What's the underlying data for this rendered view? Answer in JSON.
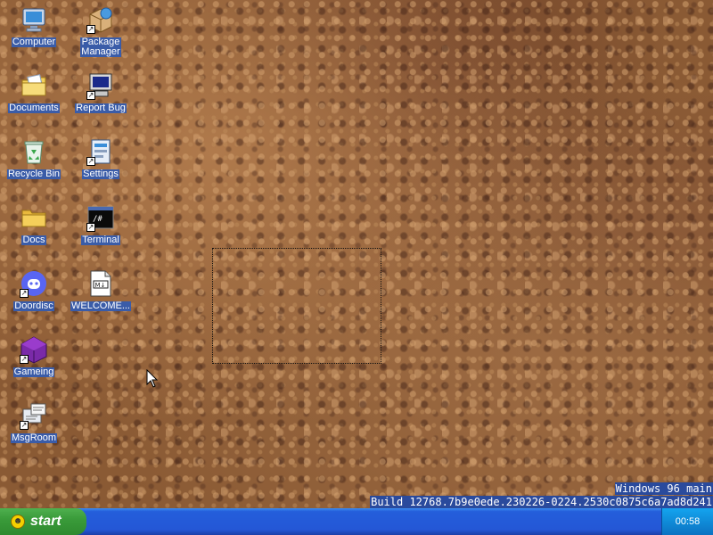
{
  "desktop": {
    "icons": [
      {
        "label": "Computer",
        "icon": "computer-icon"
      },
      {
        "label": "Package\nManager",
        "icon": "package-manager-icon"
      },
      {
        "label": "Documents",
        "icon": "documents-icon"
      },
      {
        "label": "Report Bug",
        "icon": "report-bug-icon"
      },
      {
        "label": "Recycle Bin",
        "icon": "recycle-bin-icon"
      },
      {
        "label": "Settings",
        "icon": "settings-icon"
      },
      {
        "label": "Docs",
        "icon": "folder-icon"
      },
      {
        "label": "Terminal",
        "icon": "terminal-icon",
        "glyph_text": "/#"
      },
      {
        "label": "Doordisc",
        "icon": "doordisc-icon"
      },
      {
        "label": "WELCOME...",
        "icon": "markdown-file-icon",
        "glyph_text": "M↓"
      },
      {
        "label": "Gameing",
        "icon": "gameing-icon"
      },
      {
        "label": "MsgRoom",
        "icon": "msgroom-icon"
      }
    ]
  },
  "build_banner": {
    "line1": "Windows 96 main",
    "line2": "Build 12768.7b9e0ede.230226-0224.2530c0875c6a7ad8d241"
  },
  "taskbar": {
    "start_label": "start",
    "clock": "00:58"
  },
  "colors": {
    "taskbar": "#245edb",
    "start_button": "#3a9b3a",
    "tray": "#0f8bd8",
    "label_highlight": "#3a5ca8"
  }
}
